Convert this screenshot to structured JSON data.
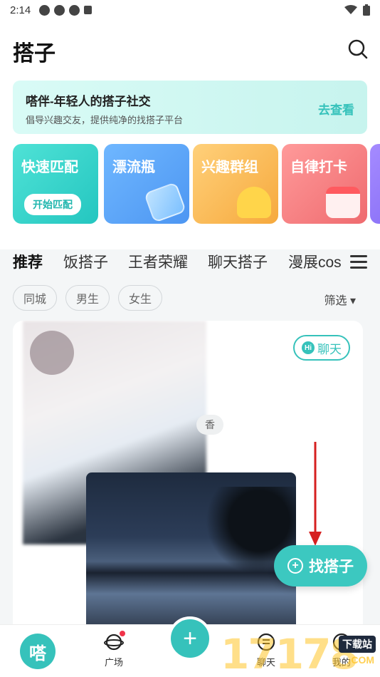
{
  "status_bar": {
    "time": "2:14"
  },
  "header": {
    "title": "搭子"
  },
  "banner": {
    "title": "嗒伴-年轻人的搭子社交",
    "subtitle": "倡导兴趣交友，提供纯净的找搭子平台",
    "link": "去查看"
  },
  "feature_cards": [
    {
      "label": "快速匹配",
      "button": "开始匹配"
    },
    {
      "label": "漂流瓶"
    },
    {
      "label": "兴趣群组"
    },
    {
      "label": "自律打卡"
    }
  ],
  "tabs": [
    "推荐",
    "饭搭子",
    "王者荣耀",
    "聊天搭子",
    "漫展cos"
  ],
  "filters": {
    "chips": [
      "同城",
      "男生",
      "女生"
    ],
    "select": "筛选 ▾"
  },
  "post": {
    "chat_button": "聊天",
    "tag": "香"
  },
  "fab": {
    "label": "找搭子"
  },
  "bottom_nav": {
    "home": "嗒",
    "square": "广场",
    "chat": "聊天",
    "me": "我的"
  },
  "watermark": {
    "number": "17178",
    "tag": "下载站",
    "domain": ".COM"
  },
  "colors": {
    "accent": "#36c2bb",
    "badge": "#f0344a"
  }
}
